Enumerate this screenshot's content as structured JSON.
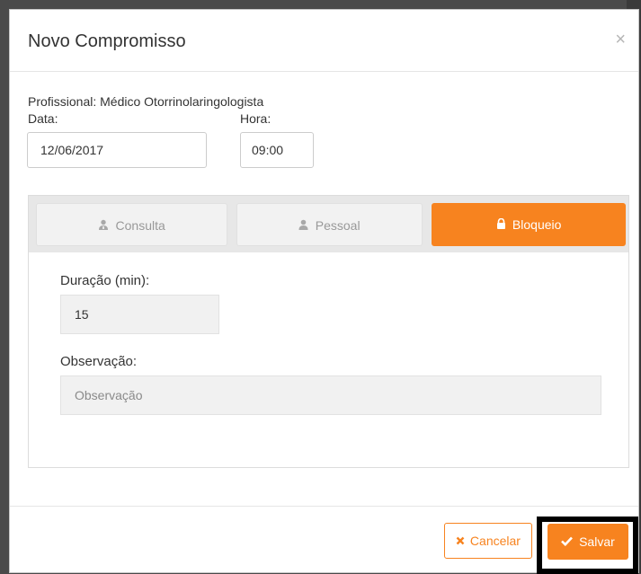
{
  "modal": {
    "title": "Novo Compromisso",
    "close_glyph": "×"
  },
  "form": {
    "professional_line": "Profissional: Médico Otorrinolaringologista",
    "date_label": "Data:",
    "date_value": "12/06/2017",
    "time_label": "Hora:",
    "time_value": "09:00"
  },
  "tabs": [
    {
      "label": "Consulta",
      "icon": "user-md-icon",
      "active": false
    },
    {
      "label": "Pessoal",
      "icon": "user-icon",
      "active": false
    },
    {
      "label": "Bloqueio",
      "icon": "lock-icon",
      "active": true
    }
  ],
  "block_form": {
    "duration_label": "Duração (min):",
    "duration_value": "15",
    "note_label": "Observação:",
    "note_placeholder": "Observação"
  },
  "footer": {
    "cancel_label": "Cancelar",
    "save_label": "Salvar"
  },
  "colors": {
    "accent": "#f7831f",
    "inactive_tab_text": "#999999"
  }
}
